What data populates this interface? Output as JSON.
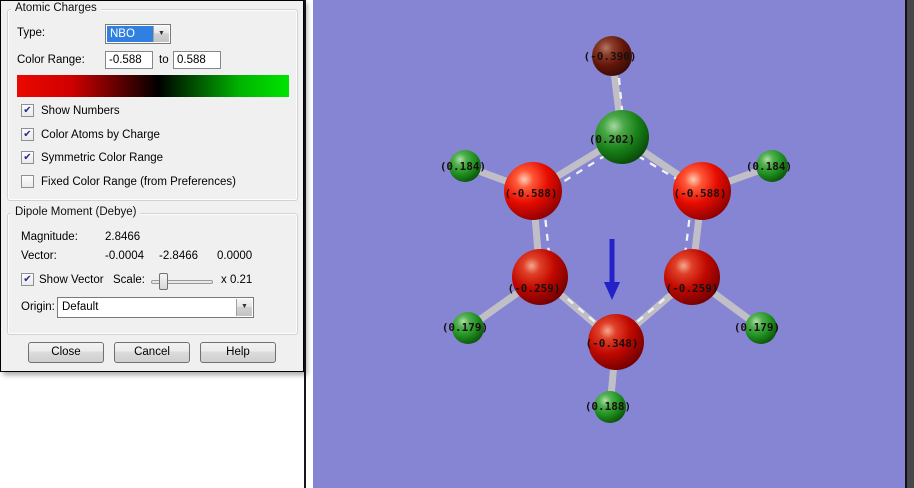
{
  "dialog": {
    "atomic_charges": {
      "title": "Atomic Charges",
      "type_label": "Type:",
      "type_value": "NBO",
      "color_range_label": "Color Range:",
      "range_min": "-0.588",
      "to_label": "to",
      "range_max": "0.588",
      "checkboxes": [
        {
          "label": "Show Numbers",
          "checked": true,
          "glyph": "✔"
        },
        {
          "label": "Color Atoms by Charge",
          "checked": true,
          "glyph": "✔"
        },
        {
          "label": "Symmetric Color Range",
          "checked": true,
          "glyph": "✔"
        },
        {
          "label": "Fixed Color Range (from Preferences)",
          "checked": false,
          "glyph": ""
        }
      ],
      "gradient_negative_color": "#ea0800",
      "gradient_zero_color": "#000000",
      "gradient_positive_color": "#00e400"
    },
    "dipole": {
      "title": "Dipole Moment (Debye)",
      "magnitude_label": "Magnitude:",
      "magnitude_value": "2.8466",
      "vector_label": "Vector:",
      "vector_x": "-0.0004",
      "vector_y": "-2.8466",
      "vector_z": "0.0000",
      "show_vector": {
        "label": "Show Vector",
        "checked": true,
        "glyph": "✔"
      },
      "scale_label": "Scale:",
      "scale_value": "x 0.21",
      "origin_label": "Origin:",
      "origin_value": "Default",
      "dropdown_glyph": "▼"
    },
    "buttons": {
      "close": "Close",
      "cancel": "Cancel",
      "help": "Help"
    },
    "type_dropdown_glyph": "▼"
  },
  "molecule": {
    "background": "#8585d3",
    "dipole_arrow_color": "#2222c8",
    "atom_labels": {
      "substituent": "(-0.390)",
      "ipso": "(0.202)",
      "ortho_left": "(-0.588)",
      "ortho_right": "(-0.588)",
      "h_ortho_left": "(0.184)",
      "h_ortho_right": "(0.184)",
      "meta_left": "(-0.259)",
      "meta_right": "(-0.259)",
      "h_meta_left": "(0.179)",
      "h_meta_right": "(0.179)",
      "para": "(-0.348)",
      "h_para": "(0.188)"
    }
  }
}
